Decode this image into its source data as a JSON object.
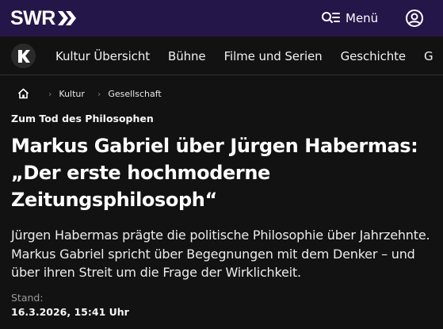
{
  "header": {
    "logo_text": "SWR",
    "menu_label": "Menü"
  },
  "kultur_nav": {
    "items": [
      {
        "label": "Kultur Übersicht"
      },
      {
        "label": "Bühne"
      },
      {
        "label": "Filme und Serien"
      },
      {
        "label": "Geschichte"
      },
      {
        "label": "G"
      }
    ]
  },
  "breadcrumb": {
    "items": [
      {
        "label": "Kultur"
      },
      {
        "label": "Gesellschaft"
      }
    ]
  },
  "article": {
    "kicker": "Zum Tod des Philosophen",
    "headline": "Markus Gabriel über Jürgen Habermas: „Der erste hochmoderne Zeitungsphilosoph“",
    "teaser": "Jürgen Habermas prägte die politische Philosophie über Jahrzehnte. Markus Gabriel spricht über Begegnungen mit dem Denker – und über ihren Streit um die Frage der Wirklichkeit.",
    "stand_label": "Stand:",
    "stand_date": "16.3.2026, 15:41 Uhr"
  },
  "colors": {
    "topbar_bg": "#25164a",
    "page_bg": "#121212"
  },
  "icons": {
    "logo_mark": "double-chevron-icon",
    "menu": "search-menu-icon",
    "account": "user-circle-icon",
    "kultur": "k-logo-icon",
    "home": "home-icon"
  }
}
